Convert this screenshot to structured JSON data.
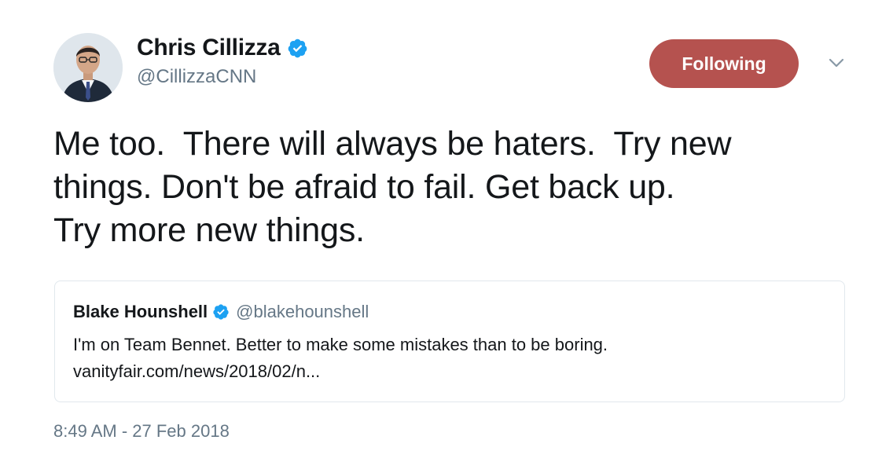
{
  "author": {
    "name": "Chris Cillizza",
    "handle": "@CillizzaCNN",
    "verified": true
  },
  "follow_button": {
    "label": "Following",
    "color": "#b5524f"
  },
  "menu_icon": "chevron-down-icon",
  "tweet": {
    "text": "Me too.  There will always be haters.  Try new\nthings. Don't be afraid to fail. Get back up.\nTry more new things."
  },
  "quoted_tweet": {
    "name": "Blake Hounshell",
    "handle": "@blakehounshell",
    "verified": true,
    "text": "I'm on Team Bennet. Better to make some mistakes than to be boring.\nvanityfair.com/news/2018/02/n..."
  },
  "timestamp": "8:49 AM - 27 Feb 2018",
  "colors": {
    "verified": "#1da1f2",
    "text": "#14171a",
    "muted": "#657786",
    "border": "#e1e8ed"
  }
}
